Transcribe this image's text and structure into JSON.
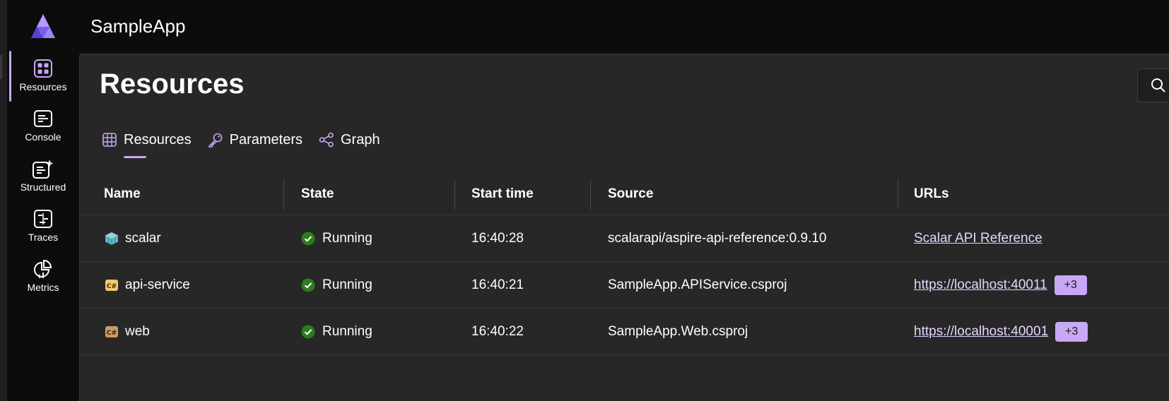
{
  "app": {
    "title": "SampleApp"
  },
  "nav": {
    "items": [
      {
        "label": "Resources",
        "icon": "resources-grid-icon",
        "active": true
      },
      {
        "label": "Console",
        "icon": "console-icon",
        "active": false
      },
      {
        "label": "Structured",
        "icon": "structured-logs-icon",
        "active": false
      },
      {
        "label": "Traces",
        "icon": "traces-icon",
        "active": false
      },
      {
        "label": "Metrics",
        "icon": "metrics-icon",
        "active": false
      }
    ]
  },
  "page": {
    "title": "Resources"
  },
  "tabs": [
    {
      "label": "Resources",
      "icon": "table-grid-icon",
      "active": true
    },
    {
      "label": "Parameters",
      "icon": "key-icon",
      "active": false
    },
    {
      "label": "Graph",
      "icon": "share-graph-icon",
      "active": false
    }
  ],
  "grid": {
    "columns": [
      "Name",
      "State",
      "Start time",
      "Source",
      "URLs"
    ],
    "rows": [
      {
        "name": "scalar",
        "type_icon": "container-icon",
        "state": "Running",
        "start_time": "16:40:28",
        "source": "scalarapi/aspire-api-reference:0.9.10",
        "url": "Scalar API Reference",
        "extra": ""
      },
      {
        "name": "api-service",
        "type_icon": "csharp-project-icon",
        "state": "Running",
        "start_time": "16:40:21",
        "source": "SampleApp.APIService.csproj",
        "url": "https://localhost:40011",
        "extra": "+3"
      },
      {
        "name": "web",
        "type_icon": "csharp-project-icon",
        "state": "Running",
        "start_time": "16:40:22",
        "source": "SampleApp.Web.csproj",
        "url": "https://localhost:40001",
        "extra": "+3"
      }
    ]
  },
  "colors": {
    "accent": "#c8a7f5",
    "running": "#2d7d1e",
    "background": "#272727",
    "nav_background": "#0c0c0c"
  }
}
